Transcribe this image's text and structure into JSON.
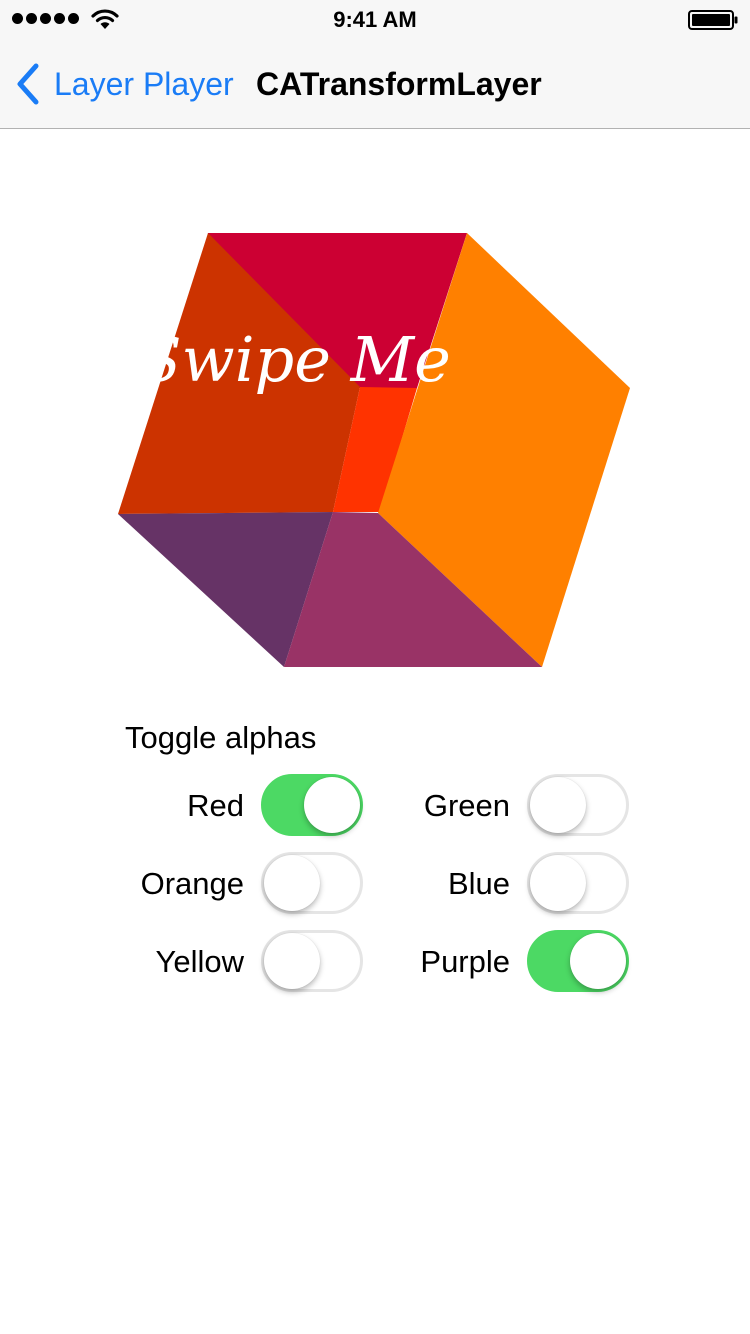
{
  "status_bar": {
    "time": "9:41 AM"
  },
  "nav": {
    "back_label": "Layer Player",
    "title": "CATransformLayer"
  },
  "cube": {
    "label": "Swipe Me",
    "colors": {
      "red": "#cc0033",
      "red_front": "#cc3300",
      "orange": "#ff8000",
      "red_orange": "#ff3300",
      "purple_light": "#993366",
      "purple_dark": "#663366"
    }
  },
  "toggles": {
    "heading": "Toggle alphas",
    "items": [
      {
        "label": "Red",
        "on": true
      },
      {
        "label": "Green",
        "on": false
      },
      {
        "label": "Orange",
        "on": false
      },
      {
        "label": "Blue",
        "on": false
      },
      {
        "label": "Yellow",
        "on": false
      },
      {
        "label": "Purple",
        "on": true
      }
    ],
    "on_color": "#4cd964"
  },
  "accent_color": "#1a7cf6"
}
